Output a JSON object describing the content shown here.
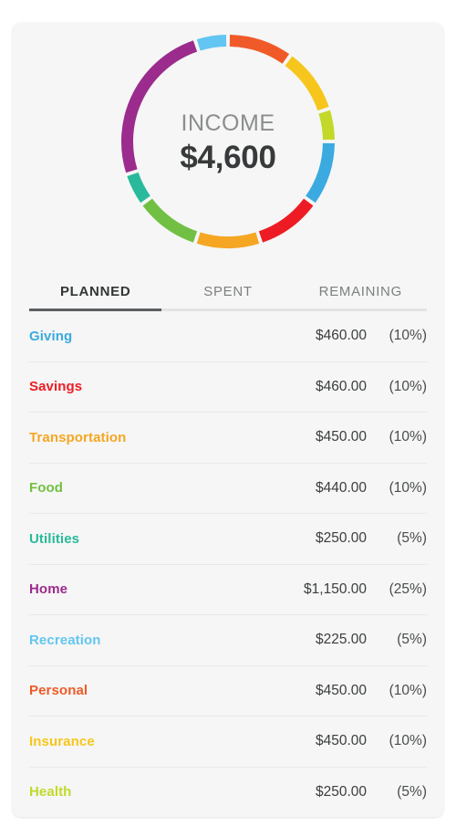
{
  "summary": {
    "label": "INCOME",
    "value": "$4,600"
  },
  "tabs": [
    {
      "label": "PLANNED",
      "active": true
    },
    {
      "label": "SPENT",
      "active": false
    },
    {
      "label": "REMAINING",
      "active": false
    }
  ],
  "categories": [
    {
      "name": "Giving",
      "amount": "$460.00",
      "percent": "(10%)",
      "color": "#3aaae1"
    },
    {
      "name": "Savings",
      "amount": "$460.00",
      "percent": "(10%)",
      "color": "#ed1c24"
    },
    {
      "name": "Transportation",
      "amount": "$450.00",
      "percent": "(10%)",
      "color": "#f5a623"
    },
    {
      "name": "Food",
      "amount": "$440.00",
      "percent": "(10%)",
      "color": "#72c043"
    },
    {
      "name": "Utilities",
      "amount": "$250.00",
      "percent": "(5%)",
      "color": "#29b99b"
    },
    {
      "name": "Home",
      "amount": "$1,150.00",
      "percent": "(25%)",
      "color": "#9b2b8c"
    },
    {
      "name": "Recreation",
      "amount": "$225.00",
      "percent": "(5%)",
      "color": "#63c6f2"
    },
    {
      "name": "Personal",
      "amount": "$450.00",
      "percent": "(10%)",
      "color": "#f05a28"
    },
    {
      "name": "Insurance",
      "amount": "$450.00",
      "percent": "(10%)",
      "color": "#f6c61c"
    },
    {
      "name": "Health",
      "amount": "$250.00",
      "percent": "(5%)",
      "color": "#c2d92a"
    }
  ],
  "chart_data": {
    "type": "pie",
    "title": "INCOME",
    "total": 4600,
    "total_label": "$4,600",
    "hole": 0.89,
    "start_angle_deg": 0,
    "direction": "clockwise",
    "gap_deg": 2,
    "segment_order": [
      "Personal",
      "Insurance",
      "Health",
      "Giving",
      "Savings",
      "Transportation",
      "Food",
      "Utilities",
      "Home",
      "Recreation"
    ],
    "labels": [
      "Personal",
      "Insurance",
      "Health",
      "Giving",
      "Savings",
      "Transportation",
      "Food",
      "Utilities",
      "Home",
      "Recreation"
    ],
    "values": [
      450,
      450,
      250,
      460,
      460,
      450,
      440,
      250,
      1150,
      225
    ],
    "percents": [
      10,
      10,
      5,
      10,
      10,
      10,
      10,
      5,
      25,
      5
    ],
    "colors": [
      "#f05a28",
      "#f6c61c",
      "#c2d92a",
      "#3aaae1",
      "#ed1c24",
      "#f5a623",
      "#72c043",
      "#29b99b",
      "#9b2b8c",
      "#63c6f2"
    ],
    "legend": "none",
    "grid": false
  }
}
